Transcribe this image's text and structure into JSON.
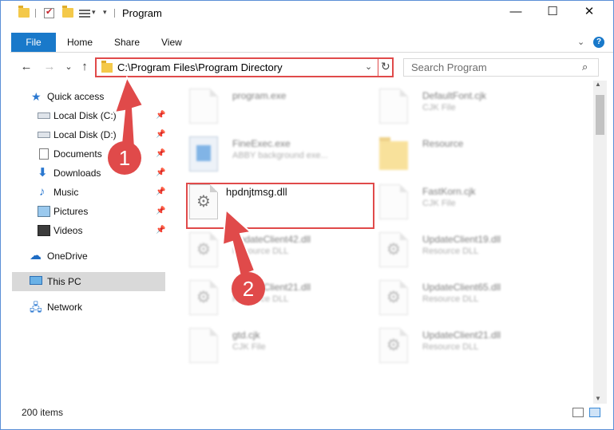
{
  "window": {
    "title": "Program",
    "min_label": "—",
    "max_label": "☐",
    "close_label": "✕"
  },
  "ribbon": {
    "tabs": [
      "File",
      "Home",
      "Share",
      "View"
    ],
    "expand_label": "⌄",
    "help_label": "?"
  },
  "nav": {
    "back": "←",
    "forward": "→",
    "recent": "⌄",
    "up": "↑"
  },
  "address": {
    "path": "C:\\Program Files\\Program Directory",
    "dropdown": "⌄",
    "refresh": "↻"
  },
  "search": {
    "placeholder": "Search Program",
    "icon": "⌕"
  },
  "sidebar": {
    "items": [
      {
        "label": "Quick access",
        "icon": "star-icon",
        "pinned": false
      },
      {
        "label": "Local Disk (C:)",
        "icon": "drive-icon",
        "pinned": true
      },
      {
        "label": "Local Disk (D:)",
        "icon": "drive-icon",
        "pinned": true
      },
      {
        "label": "Documents",
        "icon": "documents-icon",
        "pinned": true
      },
      {
        "label": "Downloads",
        "icon": "download-icon",
        "pinned": true
      },
      {
        "label": "Music",
        "icon": "music-icon",
        "pinned": true
      },
      {
        "label": "Pictures",
        "icon": "pictures-icon",
        "pinned": true
      },
      {
        "label": "Videos",
        "icon": "videos-icon",
        "pinned": true
      },
      {
        "label": "OneDrive",
        "icon": "onedrive-icon",
        "pinned": false
      },
      {
        "label": "This PC",
        "icon": "this-pc-icon",
        "pinned": false,
        "selected": true
      },
      {
        "label": "Network",
        "icon": "network-icon",
        "pinned": false
      }
    ],
    "pin_glyph": "📌"
  },
  "files": {
    "left": [
      {
        "name": "program.exe",
        "sub": "",
        "icon": "installer-icon"
      },
      {
        "name": "FineExec.exe",
        "sub": "ABBY background exe...",
        "icon": "exe-icon"
      },
      {
        "name": "hpdnjtmsg.dll",
        "sub": "",
        "icon": "dll-icon"
      },
      {
        "name": "UpdateClient42.dll",
        "sub": "Resource DLL",
        "icon": "dll-icon"
      },
      {
        "name": "UpdateClient21.dll",
        "sub": "Resource DLL",
        "icon": "dll-icon"
      },
      {
        "name": "gtd.cjk",
        "sub": "CJK File",
        "icon": "file-icon"
      }
    ],
    "right": [
      {
        "name": "DefaultFont.cjk",
        "sub": "CJK File",
        "icon": "file-icon"
      },
      {
        "name": "Resource",
        "sub": "",
        "icon": "folder-icon"
      },
      {
        "name": "FastKorn.cjk",
        "sub": "CJK File",
        "icon": "file-icon"
      },
      {
        "name": "UpdateClient19.dll",
        "sub": "Resource DLL",
        "icon": "dll-icon"
      },
      {
        "name": "UpdateClient65.dll",
        "sub": "Resource DLL",
        "icon": "dll-icon"
      },
      {
        "name": "UpdateClient21.dll",
        "sub": "Resource DLL",
        "icon": "dll-icon"
      }
    ]
  },
  "callouts": {
    "step1": "1",
    "step2": "2"
  },
  "status": {
    "item_count": "200 items"
  },
  "colors": {
    "accent": "#1979ca",
    "highlight": "#e04a4a"
  }
}
